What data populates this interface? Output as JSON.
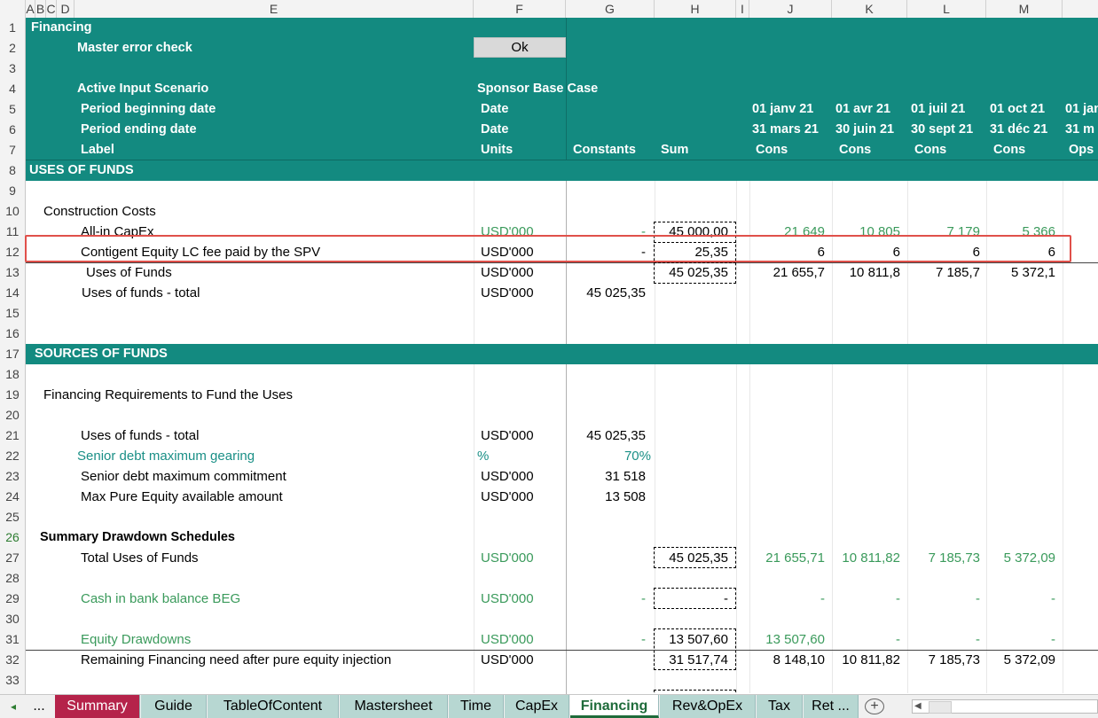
{
  "columns": [
    "A",
    "B",
    "C",
    "D",
    "E",
    "F",
    "G",
    "H",
    "I",
    "J",
    "K",
    "L",
    "M"
  ],
  "rows": [
    "1",
    "2",
    "3",
    "4",
    "5",
    "6",
    "7",
    "8",
    "9",
    "10",
    "11",
    "12",
    "13",
    "14",
    "15",
    "16",
    "17",
    "18",
    "19",
    "20",
    "21",
    "22",
    "23",
    "24",
    "25",
    "26",
    "27",
    "28",
    "29",
    "30",
    "31",
    "32",
    "33"
  ],
  "header": {
    "title": "Financing",
    "master_error_check": "Master error check",
    "ok": "Ok",
    "active_input_scenario": "Active Input Scenario",
    "scenario_value": "Sponsor Base Case",
    "period_beginning": "Period beginning date",
    "period_ending": "Period ending date",
    "label": "Label",
    "date": "Date",
    "units": "Units",
    "constants": "Constants",
    "sum": "Sum",
    "begin_dates": [
      "01 janv 21",
      "01 avr 21",
      "01 juil 21",
      "01 oct 21",
      "01 jan"
    ],
    "end_dates": [
      "31 mars 21",
      "30 juin 21",
      "30 sept 21",
      "31 déc 21",
      "31 m"
    ],
    "period_labels": [
      "Cons",
      "Cons",
      "Cons",
      "Cons",
      "Ops"
    ]
  },
  "sections": {
    "uses": "USES OF FUNDS",
    "sources": "SOURCES OF FUNDS"
  },
  "uses": {
    "construction_costs": "Construction Costs",
    "capex": {
      "label": "All-in CapEx",
      "units": "USD'000",
      "constant": "-",
      "sum": "45 000,00",
      "values": [
        "21 649",
        "10 805",
        "7 179",
        "5 366"
      ]
    },
    "lc_fee": {
      "label": "Contigent Equity LC fee paid by the SPV",
      "units": "USD'000",
      "constant": "-",
      "sum": "25,35",
      "values": [
        "6",
        "6",
        "6",
        "6"
      ]
    },
    "uses_of_funds": {
      "label": "Uses of Funds",
      "units": "USD'000",
      "sum": "45 025,35",
      "values": [
        "21 655,7",
        "10 811,8",
        "7 185,7",
        "5 372,1"
      ]
    },
    "uses_total": {
      "label": "Uses of funds - total",
      "units": "USD'000",
      "constant": "45 025,35"
    }
  },
  "sources": {
    "fin_req": "Financing Requirements to Fund the Uses",
    "uses_total": {
      "label": "Uses of funds - total",
      "units": "USD'000",
      "constant": "45 025,35"
    },
    "gearing": {
      "label": "Senior debt maximum gearing",
      "units": "%",
      "constant": "70%"
    },
    "commitment": {
      "label": "Senior debt maximum commitment",
      "units": "USD'000",
      "constant": "31 518"
    },
    "max_equity": {
      "label": "Max Pure Equity available amount",
      "units": "USD'000",
      "constant": "13 508"
    },
    "summary": "Summary Drawdown Schedules",
    "total_uses": {
      "label": "Total Uses of Funds",
      "units": "USD'000",
      "sum": "45 025,35",
      "values": [
        "21 655,71",
        "10 811,82",
        "7 185,73",
        "5 372,09"
      ]
    },
    "cash_beg": {
      "label": "Cash in bank balance BEG",
      "units": "USD'000",
      "constant": "-",
      "sum": "-",
      "values": [
        "-",
        "-",
        "-",
        "-"
      ]
    },
    "equity": {
      "label": "Equity  Drawdowns",
      "units": "USD'000",
      "constant": "-",
      "sum": "13 507,60",
      "values": [
        "13 507,60",
        "-",
        "-",
        "-"
      ]
    },
    "remaining": {
      "label": "Remaining Financing need after pure equity injection",
      "units": "USD'000",
      "sum": "31 517,74",
      "values": [
        "8 148,10",
        "10 811,82",
        "7 185,73",
        "5 372,09"
      ]
    }
  },
  "tabs": {
    "nav_prev": "◂",
    "nav_more": "...",
    "items": [
      "Summary",
      "Guide",
      "TableOfContent",
      "Mastersheet",
      "Time",
      "CapEx",
      "Financing",
      "Rev&OpEx",
      "Tax",
      "Ret ..."
    ],
    "active": "Financing",
    "add": "+"
  },
  "colors": {
    "teal": "#138a80",
    "summary_tab": "#b5234a",
    "tab_bg": "#b7d7d2"
  }
}
